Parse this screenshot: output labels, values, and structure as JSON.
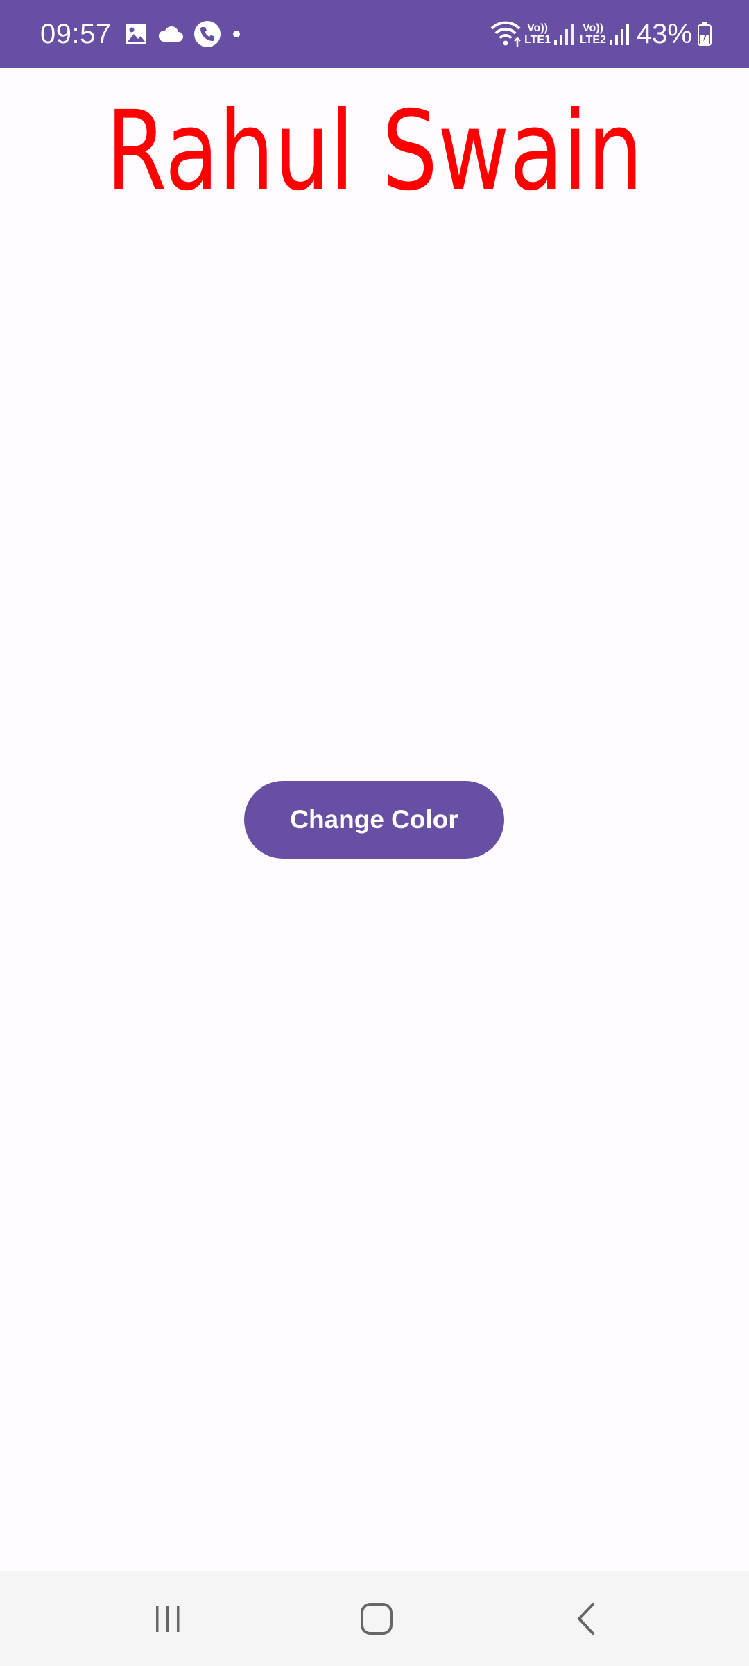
{
  "status_bar": {
    "time": "09:57",
    "icons_left": [
      "gallery-icon",
      "cloud-icon",
      "phone-call-icon",
      "dot-icon"
    ],
    "sim1_top": "Vo))",
    "sim1_bottom": "LTE1",
    "sim2_top": "Vo))",
    "sim2_bottom": "LTE2",
    "battery_percent": "43%",
    "background_color": "#6750a4"
  },
  "main": {
    "title": "Rahul Swain",
    "title_color": "#ff0000",
    "button_label": "Change Color",
    "button_color": "#6750a4"
  },
  "nav_bar": {
    "buttons": [
      "recent-apps-icon",
      "home-icon",
      "back-icon"
    ]
  }
}
